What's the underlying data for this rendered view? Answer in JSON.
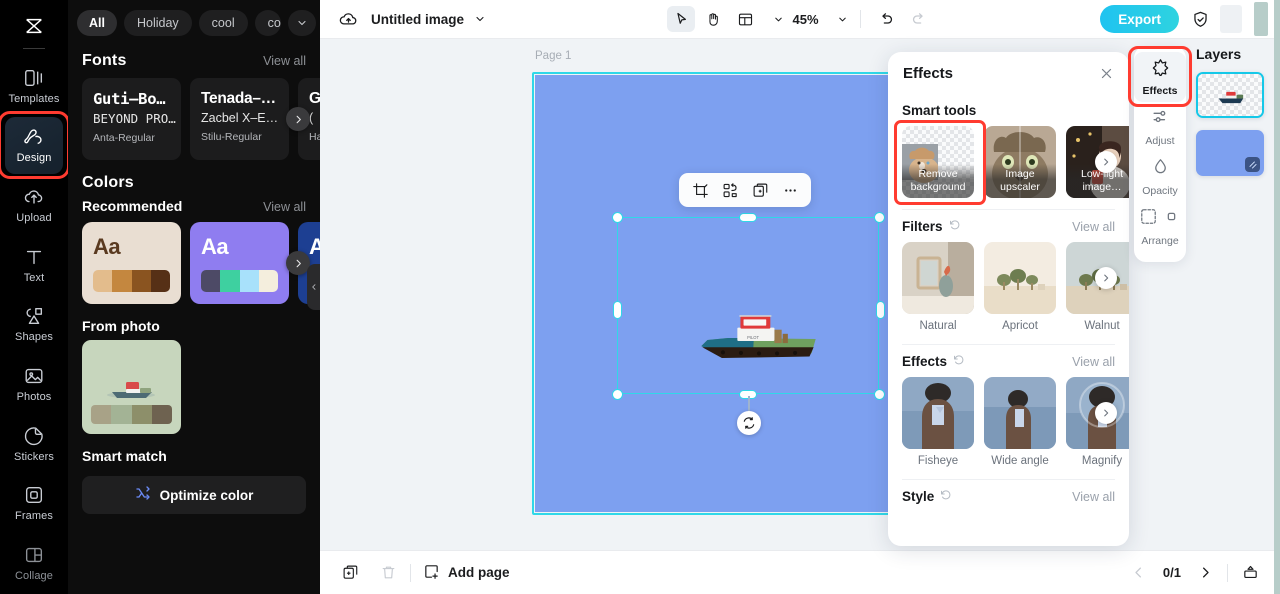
{
  "app": {
    "logo_icon": "capcut-logo-icon"
  },
  "rail": {
    "items": [
      {
        "label": "Templates",
        "icon": "templates-icon",
        "active": false
      },
      {
        "label": "Design",
        "icon": "design-icon",
        "active": true
      },
      {
        "label": "Upload",
        "icon": "upload-icon",
        "active": false
      },
      {
        "label": "Text",
        "icon": "text-icon",
        "active": false
      },
      {
        "label": "Shapes",
        "icon": "shapes-icon",
        "active": false
      },
      {
        "label": "Photos",
        "icon": "photos-icon",
        "active": false
      },
      {
        "label": "Stickers",
        "icon": "stickers-icon",
        "active": false
      },
      {
        "label": "Frames",
        "icon": "frames-icon",
        "active": false
      },
      {
        "label": "Collage",
        "icon": "collage-icon",
        "active": false
      }
    ]
  },
  "left_panel": {
    "chips": [
      "All",
      "Holiday",
      "cool",
      "concise"
    ],
    "chips_more_icon": "chevron-down-icon",
    "fonts": {
      "title": "Fonts",
      "view_all": "View all",
      "cards": [
        {
          "line1": "Guti–Bo…",
          "line2": "BEYOND PRO…",
          "line3": "Anta-Regular"
        },
        {
          "line1": "Tenada–…",
          "line2": "Zacbel X–E…",
          "line3": "Stilu-Regular"
        },
        {
          "line1": "Gl",
          "line2": "(",
          "line3": "Ham"
        }
      ]
    },
    "colors": {
      "title": "Colors",
      "recommended_label": "Recommended",
      "view_all": "View all",
      "palettes": [
        {
          "aa": "Aa",
          "bg": "#e9ded2",
          "text": "#5a3a20",
          "swatches": [
            "#e3bc8c",
            "#c4873f",
            "#8a5420",
            "#563016"
          ]
        },
        {
          "aa": "Aa",
          "bg": "#8f7df0",
          "text": "#ffffff",
          "swatches": [
            "#4d4a66",
            "#3ed0a0",
            "#a8e1fb",
            "#f4eedd"
          ]
        },
        {
          "aa": "A",
          "bg": "#1d3f92",
          "text": "#ffffff",
          "swatches": [
            "#5b85c9"
          ]
        }
      ],
      "from_photo_label": "From photo",
      "from_photo_swatches": [
        "#a8a287",
        "#a3b395",
        "#8d8f6a",
        "#6e6250"
      ],
      "smart_match_label": "Smart match",
      "optimize_label": "Optimize color",
      "optimize_icon": "shuffle-icon"
    }
  },
  "topbar": {
    "cloud_icon": "cloud-sync-icon",
    "doc_title": "Untitled image",
    "title_caret_icon": "chevron-down-icon",
    "tools": [
      {
        "name": "select-tool",
        "icon": "cursor-arrow-icon",
        "active": true
      },
      {
        "name": "hand-tool",
        "icon": "hand-icon",
        "active": false
      },
      {
        "name": "layout-tool",
        "icon": "layout-icon",
        "active": false
      }
    ],
    "zoom_level": "45%",
    "zoom_caret_icon": "chevron-down-icon",
    "undo_icon": "undo-icon",
    "redo_icon": "redo-icon",
    "export_label": "Export",
    "shield_icon": "shield-check-icon"
  },
  "canvas": {
    "page_label": "Page 1",
    "artboard_color": "#7da0f0",
    "float_tools": [
      {
        "name": "crop-button",
        "icon": "crop-icon"
      },
      {
        "name": "remove-background-button",
        "icon": "magic-cutout-icon"
      },
      {
        "name": "duplicate-button",
        "icon": "duplicate-icon"
      },
      {
        "name": "more-options-button",
        "icon": "ellipsis-icon"
      }
    ],
    "rotate_icon": "rotate-icon"
  },
  "bottombar": {
    "duplicate_page_icon": "duplicate-page-icon",
    "delete_page_icon": "trash-icon",
    "add_page_label": "Add page",
    "add_page_icon": "add-page-icon",
    "prev_icon": "chevron-left-icon",
    "page_indicator": "0/1",
    "next_icon": "chevron-right-icon",
    "present_icon": "present-icon"
  },
  "effects_panel": {
    "title": "Effects",
    "close_icon": "close-icon",
    "sections": [
      {
        "name": "smart-tools",
        "title": "Smart tools",
        "has_reset": false,
        "view_all": null,
        "items": [
          {
            "caption": "Remove background",
            "overlay": true,
            "highlighted": true
          },
          {
            "caption": "Image upscaler",
            "overlay": true,
            "highlighted": false
          },
          {
            "caption": "Low-light image…",
            "overlay": true,
            "highlighted": false
          }
        ]
      },
      {
        "name": "filters",
        "title": "Filters",
        "has_reset": true,
        "view_all": "View all",
        "items": [
          {
            "caption": "Natural",
            "overlay": false,
            "highlighted": false
          },
          {
            "caption": "Apricot",
            "overlay": false,
            "highlighted": false
          },
          {
            "caption": "Walnut",
            "overlay": false,
            "highlighted": false
          }
        ]
      },
      {
        "name": "effects",
        "title": "Effects",
        "has_reset": true,
        "view_all": "View all",
        "items": [
          {
            "caption": "Fisheye",
            "overlay": false,
            "highlighted": false
          },
          {
            "caption": "Wide angle",
            "overlay": false,
            "highlighted": false
          },
          {
            "caption": "Magnify",
            "overlay": false,
            "highlighted": false
          }
        ]
      },
      {
        "name": "style",
        "title": "Style",
        "has_reset": true,
        "view_all": "View all",
        "items": []
      }
    ],
    "next_icon": "chevron-right-icon",
    "reset_icon": "reset-icon"
  },
  "right_rail": {
    "items": [
      {
        "label": "Effects",
        "icon": "effects-icon",
        "active": true,
        "highlighted": true
      },
      {
        "label": "Adjust",
        "icon": "adjust-icon",
        "active": false,
        "highlighted": false
      },
      {
        "label": "Opacity",
        "icon": "opacity-icon",
        "active": false,
        "highlighted": false
      },
      {
        "label": "Arrange",
        "icon": "arrange-icon",
        "active": false,
        "highlighted": false
      }
    ]
  },
  "layers": {
    "title": "Layers",
    "items": [
      {
        "name": "layer-boat-image",
        "selected": true,
        "type": "image"
      },
      {
        "name": "layer-background",
        "selected": false,
        "type": "background"
      }
    ],
    "background_color": "#7da0f0"
  },
  "accent": {
    "brand_cyan": "#2fd8e8",
    "highlight_red": "#ff3b30",
    "export_gradient_start": "#1fc3f0",
    "export_gradient_end": "#2ed3e0"
  }
}
